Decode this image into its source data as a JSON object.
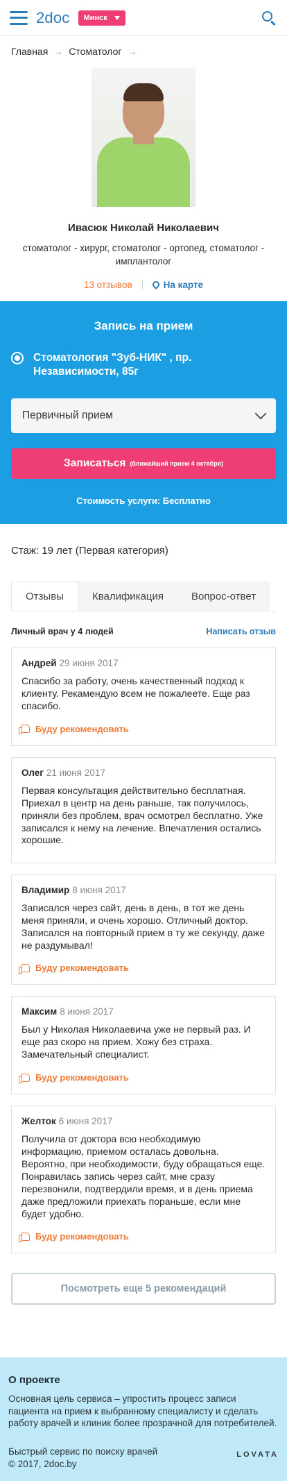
{
  "header": {
    "logo": "2doc",
    "city": "Минск"
  },
  "breadcrumb": {
    "home": "Главная",
    "section": "Стоматолог",
    "arrow": "→"
  },
  "doctor": {
    "name": "Ивасюк Николай Николаевич",
    "specialty": "стоматолог - хирург, стоматолог - ортопед, стоматолог - имплантолог",
    "reviews_link": "13 отзывов",
    "map_link": "На карте"
  },
  "booking": {
    "title": "Запись на прием",
    "clinic": "Стоматология \"Зуб-НИК\" , пр. Независимости, 85г",
    "visit_type": "Первичный прием",
    "button": "Записаться",
    "button_note": "(ближайший прием 4 октября)",
    "price": "Стоимость услуги: Бесплатно"
  },
  "experience": "Стаж: 19 лет (Первая категория)",
  "tabs": [
    "Отзывы",
    "Квалификация",
    "Вопрос-ответ"
  ],
  "reviews_header": {
    "personal_doctor": "Личный врач у 4 людей",
    "write_review": "Написать отзыв"
  },
  "recommend_label": "Буду рекомендовать",
  "reviews": [
    {
      "author": "Андрей",
      "date": "29 июня 2017",
      "text": "Спасибо за работу, очень качественный подход к клиенту. Рекамендую всем не пожалеете. Еще раз спасибо."
    },
    {
      "author": "Олег",
      "date": "21 июня 2017",
      "text": "Первая консультация действительно бесплатная. Приехал в центр на день раньше, так получилось, приняли без проблем, врач осмотрел бесплатно. Уже записался к нему на лечение. Впечатления остались хорошие."
    },
    {
      "author": "Владимир",
      "date": "8 июня 2017",
      "text": "Записался через сайт, день в день, в тот же день меня приняли, и очень хорошо. Отличный доктор. Записался на повторный прием в ту же секунду, даже не раздумывал!"
    },
    {
      "author": "Максим",
      "date": "8 июня 2017",
      "text": "Был у Николая Николаевича уже не первый раз. И еще раз скоро на прием. Хожу без страха. Замечательный специалист."
    },
    {
      "author": "Желток",
      "date": "6 июня 2017",
      "text": "Получила от доктора всю необходимую информацию, приемом осталась довольна. Вероятно, при необходимости, буду обращаться еще. Понравилась запись через сайт, мне сразу перезвонили, подтвердили время, и в день приема даже предложили приехать пораньше, если мне будет удобно."
    }
  ],
  "more_button": "Посмотреть еще 5 рекомендаций",
  "footer": {
    "about_title": "О проекте",
    "about_text": "Основная цель сервиса – упростить процесс записи пациента на прием к выбранному специалисту и сделать работу врачей и клиник более прозрачной для потребителей.",
    "tagline": "Быстрый сервис по поиску врачей",
    "copyright": "© 2017, 2doc.by",
    "partner": "LOVATA"
  },
  "colors": {
    "brand_blue": "#2b7bb9",
    "booking_bg": "#1c9ee2",
    "accent_pink": "#ef3e76",
    "orange": "#ef7a34",
    "footer_bg": "#bfe9f9"
  }
}
